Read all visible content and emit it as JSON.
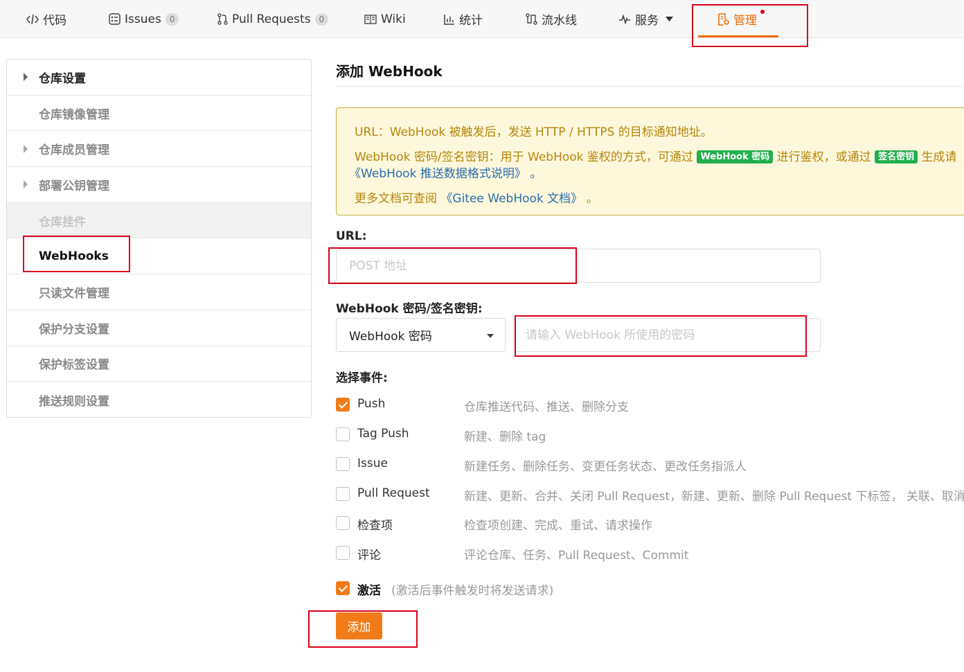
{
  "nav": {
    "code": "代码",
    "issues": "Issues",
    "issues_count": "0",
    "pulls": "Pull Requests",
    "pulls_count": "0",
    "wiki": "Wiki",
    "stats": "统计",
    "pipeline": "流水线",
    "services": "服务",
    "manage": "管理"
  },
  "sidebar": {
    "items": [
      {
        "label": "仓库设置"
      },
      {
        "label": "仓库镜像管理"
      },
      {
        "label": "仓库成员管理"
      },
      {
        "label": "部署公钥管理"
      },
      {
        "label": "仓库挂件"
      },
      {
        "label": "WebHooks"
      },
      {
        "label": "只读文件管理"
      },
      {
        "label": "保护分支设置"
      },
      {
        "label": "保护标签设置"
      },
      {
        "label": "推送规则设置"
      }
    ]
  },
  "main": {
    "title": "添加 WebHook",
    "notice": {
      "line1": "URL：WebHook 被触发后，发送 HTTP / HTTPS 的目标通知地址。",
      "line2a": "WebHook 密码/签名密钥：用于 WebHook 鉴权的方式，可通过",
      "tag1": "WebHook 密码",
      "line2b": "进行鉴权，或通过",
      "tag2": "签名密钥",
      "line2c": "生成请",
      "line3": "《WebHook 推送数据格式说明》",
      "line3_tail": "。",
      "line4a": "更多文档可查阅",
      "line4_link": "《Gitee WebHook 文档》",
      "line4_tail": "。"
    },
    "url_label": "URL:",
    "url_placeholder": "POST 地址",
    "secret_label": "WebHook 密码/签名密钥:",
    "secret_select": "WebHook 密码",
    "secret_placeholder": "请输入 WebHook 所使用的密码",
    "events_label": "选择事件:",
    "events": [
      {
        "name": "Push",
        "desc": "仓库推送代码、推送、删除分支",
        "checked": true
      },
      {
        "name": "Tag Push",
        "desc": "新建、删除 tag",
        "checked": false
      },
      {
        "name": "Issue",
        "desc": "新建任务、删除任务、变更任务状态、更改任务指派人",
        "checked": false
      },
      {
        "name": "Pull Request",
        "desc": "新建、更新、合并、关闭 Pull Request，新建、更新、删除 Pull Request 下标签， 关联、取消关",
        "checked": false
      },
      {
        "name": "检查项",
        "desc": "检查项创建、完成、重试、请求操作",
        "checked": false
      },
      {
        "name": "评论",
        "desc": "评论仓库、任务、Pull Request、Commit",
        "checked": false
      }
    ],
    "activate_label": "激活",
    "activate_hint": "(激活后事件触发时将发送请求)",
    "activate_checked": true,
    "add_button": "添加"
  },
  "colors": {
    "accent": "#f27b19",
    "highlight_box": "#d9001b",
    "notice_bg": "#fdf8dc",
    "tag_green": "#21b04b"
  }
}
